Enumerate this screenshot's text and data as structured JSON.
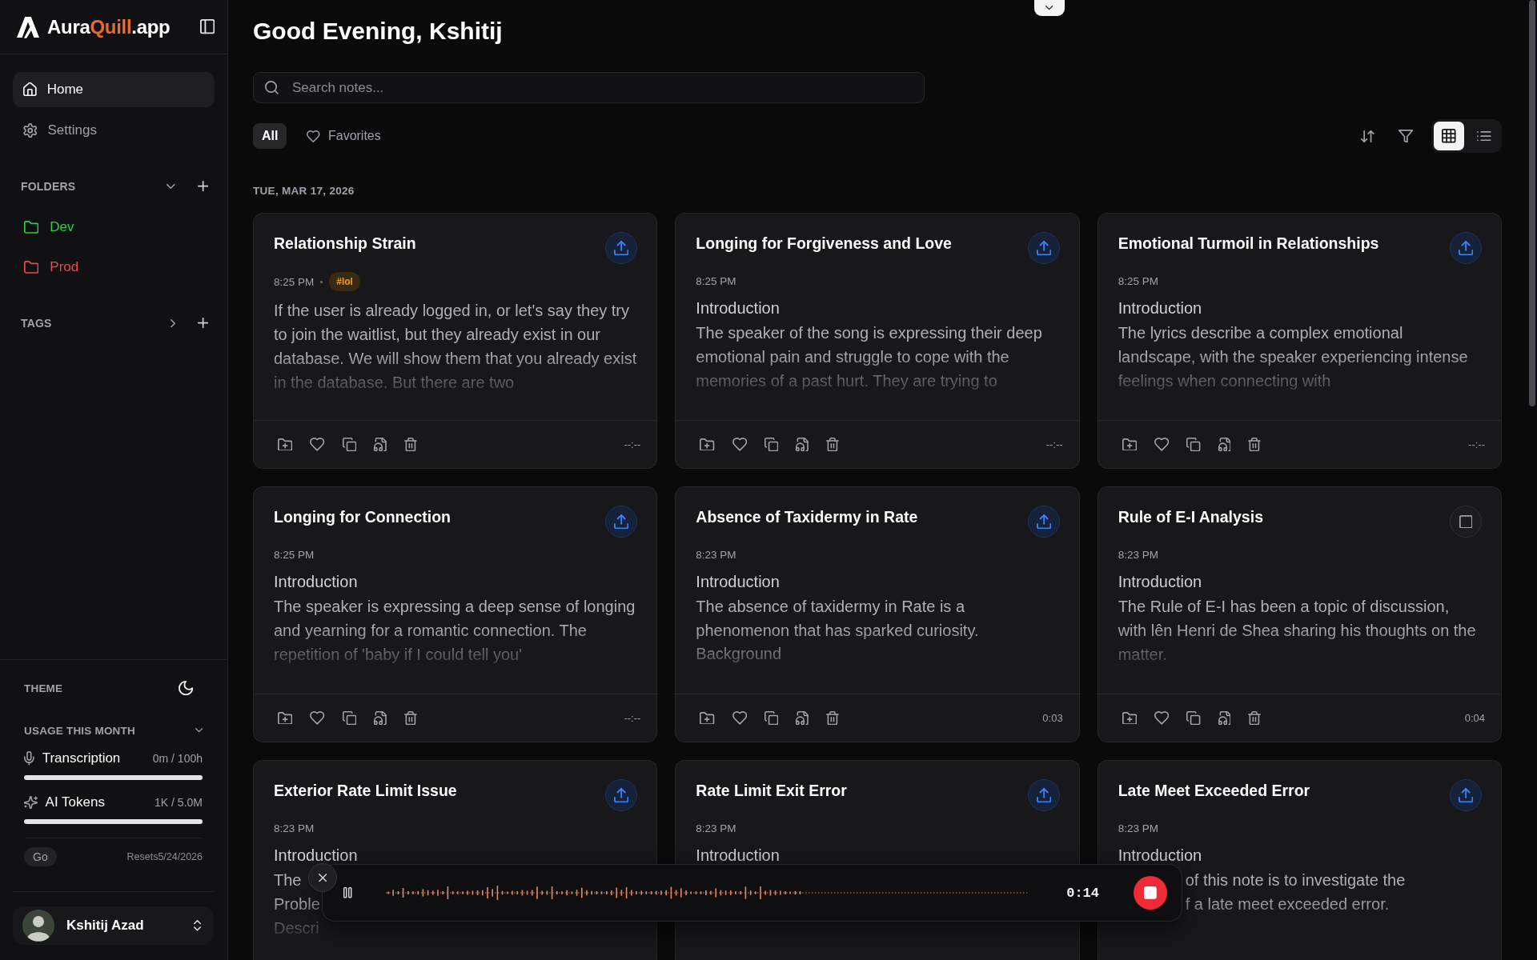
{
  "sidebar": {
    "brand": {
      "name": "Aura",
      "accent": "Quill",
      "suffix": ".app"
    },
    "nav": [
      {
        "kind": "home",
        "label": "Home",
        "selected": true
      },
      {
        "kind": "settings",
        "label": "Settings",
        "selected": false
      }
    ],
    "folders": {
      "title": "FOLDERS",
      "expanded": true,
      "items": [
        {
          "label": "Dev",
          "color": "#31c94e"
        },
        {
          "label": "Prod",
          "color": "#e5485d"
        }
      ]
    },
    "tags": {
      "title": "TAGS",
      "expanded": false
    },
    "theme": {
      "label": "THEME",
      "dark": true
    },
    "usage": {
      "title": "USAGE THIS MONTH",
      "expanded": true,
      "meters": [
        {
          "kind": "transcription",
          "label": "Transcription",
          "reading": "0m / 100h",
          "level": 0
        },
        {
          "kind": "tokens",
          "label": "AI Tokens",
          "reading": "1K / 5.0M",
          "level": 0
        }
      ],
      "plan": "Go",
      "resets": "Resets5/24/2026"
    },
    "user": {
      "name": "Kshitij Azad"
    }
  },
  "main": {
    "greeting": "Good Evening, Kshitij",
    "search": {
      "placeholder": "Search notes..."
    },
    "filters": [
      {
        "kind": "all",
        "label": "All",
        "selected": true
      },
      {
        "kind": "favorites",
        "label": "Favorites",
        "selected": false
      }
    ],
    "view_modes": [
      {
        "kind": "grid",
        "selected": true
      },
      {
        "kind": "list",
        "selected": false
      }
    ],
    "date": "TUE, MAR 17, 2026",
    "notes": [
      {
        "title": "Relationship Strain",
        "time": "8:25 PM",
        "tags": [
          "#lol"
        ],
        "content": [
          {
            "kind": "paragraph",
            "text": "If the user is already logged in, or let's say they try to join the waitlist, but they already exist in our database. We will show them that you already exist in the database. But there are two"
          }
        ],
        "action": {
          "kind": "upload"
        },
        "duration": "--:--"
      },
      {
        "title": "Longing for Forgiveness and Love",
        "time": "8:25 PM",
        "content": [
          {
            "kind": "heading",
            "text": "Introduction"
          },
          {
            "kind": "paragraph",
            "text": "The speaker of the song is expressing their deep emotional pain and struggle to cope with the memories of a past hurt. They are trying to"
          }
        ],
        "action": {
          "kind": "upload"
        },
        "duration": "--:--"
      },
      {
        "title": "Emotional Turmoil in Relationships",
        "time": "8:25 PM",
        "content": [
          {
            "kind": "heading",
            "text": "Introduction"
          },
          {
            "kind": "paragraph",
            "text": "The lyrics describe a complex emotional landscape, with the speaker experiencing intense feelings when connecting with"
          }
        ],
        "action": {
          "kind": "upload"
        },
        "duration": "--:--"
      },
      {
        "title": "Longing for Connection",
        "time": "8:25 PM",
        "content": [
          {
            "kind": "heading",
            "text": "Introduction"
          },
          {
            "kind": "paragraph",
            "text": "The speaker is expressing a deep sense of longing and yearning for a romantic connection. The repetition of 'baby if I could tell you'"
          }
        ],
        "action": {
          "kind": "upload"
        },
        "duration": "--:--"
      },
      {
        "title": "Absence of Taxidermy in Rate",
        "time": "8:23 PM",
        "content": [
          {
            "kind": "heading",
            "text": "Introduction"
          },
          {
            "kind": "paragraph",
            "text": "The absence of taxidermy in Rate is a phenomenon that has sparked curiosity."
          },
          {
            "kind": "heading",
            "text": "Background"
          }
        ],
        "action": {
          "kind": "upload"
        },
        "duration": "0:03"
      },
      {
        "title": "Rule of E-I Analysis",
        "time": "8:23 PM",
        "content": [
          {
            "kind": "heading",
            "text": "Introduction"
          },
          {
            "kind": "paragraph",
            "text": "The Rule of E-I has been a topic of discussion, with lên Henri de Shea sharing his thoughts on the matter."
          }
        ],
        "action": {
          "kind": "square"
        },
        "duration": "0:04"
      },
      {
        "title": "Exterior Rate Limit Issue",
        "time": "8:23 PM",
        "content": [
          {
            "kind": "heading",
            "text": "Introduction"
          },
          {
            "kind": "paragraph",
            "text": "The\nProble\nDescri"
          }
        ],
        "action": {
          "kind": "upload"
        }
      },
      {
        "title": "Rate Limit Exit Error",
        "time": "8:23 PM",
        "content": [
          {
            "kind": "heading",
            "text": "Introduction"
          }
        ],
        "action": {
          "kind": "upload"
        }
      },
      {
        "title": "Late Meet Exceeded Error",
        "time": "8:23 PM",
        "content": [
          {
            "kind": "heading",
            "text": "Introduction"
          },
          {
            "kind": "paragraph",
            "text": "of this note is to investigate the\nf a late meet exceeded error."
          }
        ],
        "action": {
          "kind": "upload"
        }
      }
    ]
  },
  "recorder": {
    "paused": false,
    "time": "0:14"
  }
}
